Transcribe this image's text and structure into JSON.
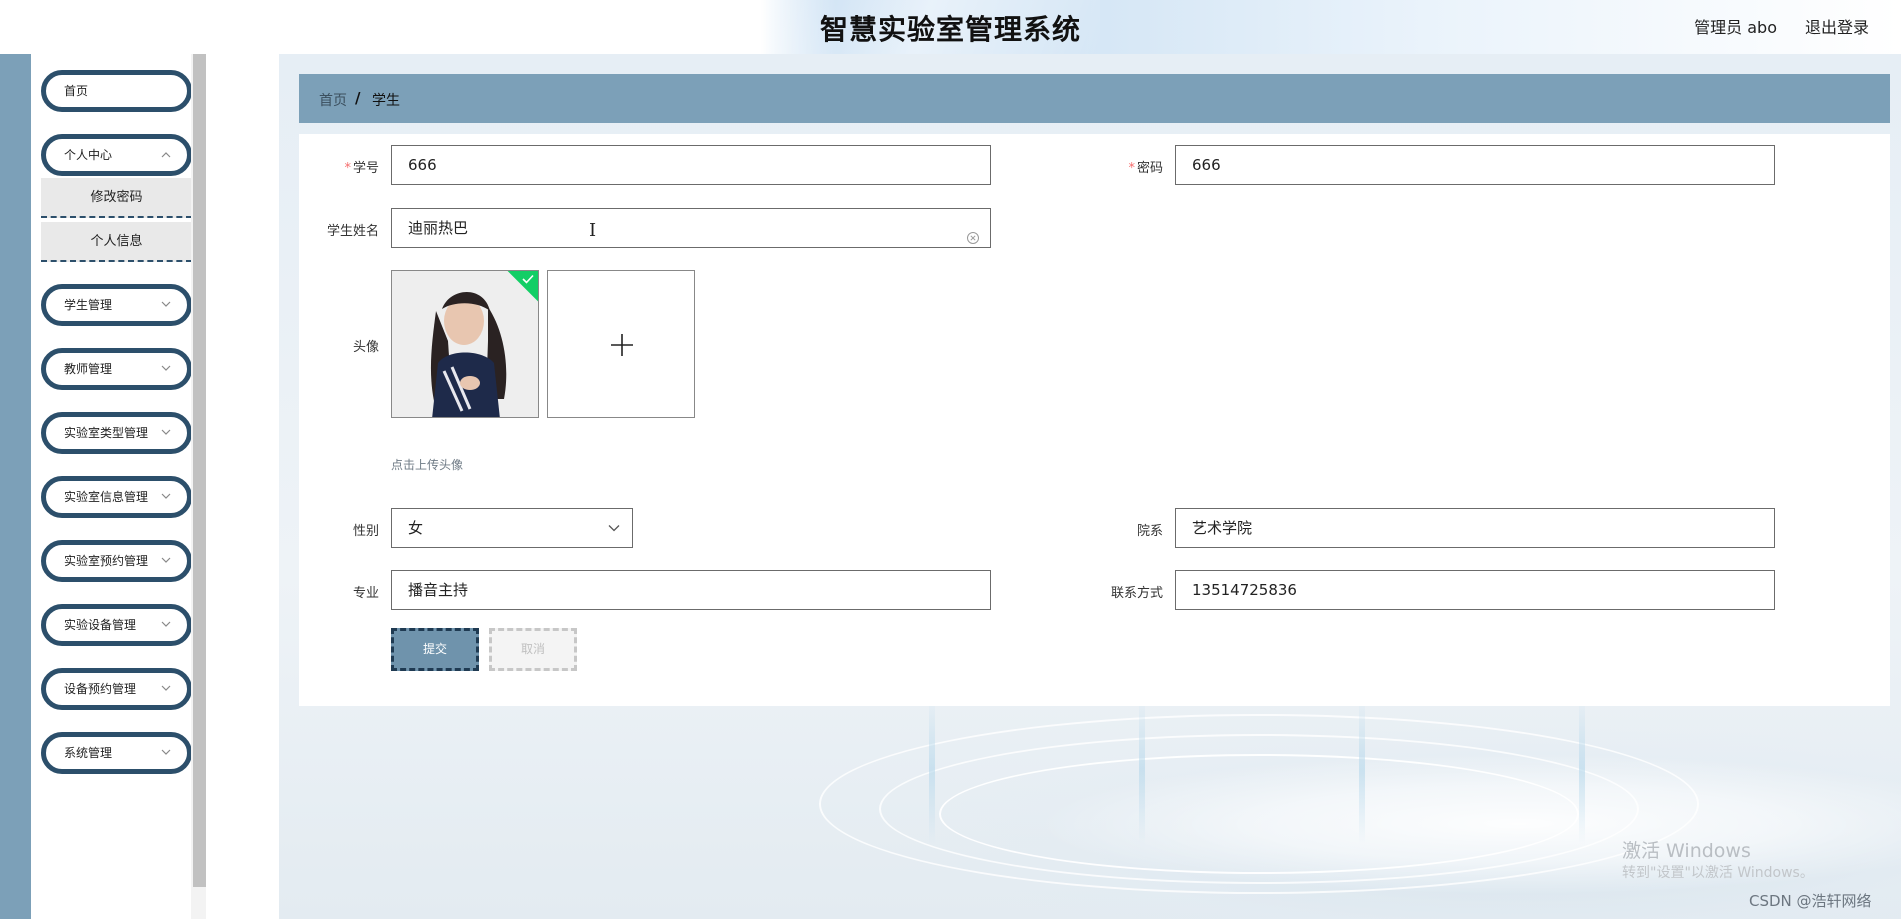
{
  "header": {
    "title": "智慧实验室管理系统",
    "user": "管理员 abo",
    "logout": "退出登录"
  },
  "sidebar": {
    "items": [
      {
        "label": "首页",
        "has_chevron": false
      },
      {
        "label": "个人中心",
        "has_chevron": true,
        "expanded": true
      },
      {
        "label": "学生管理",
        "has_chevron": true
      },
      {
        "label": "教师管理",
        "has_chevron": true
      },
      {
        "label": "实验室类型管理",
        "has_chevron": true
      },
      {
        "label": "实验室信息管理",
        "has_chevron": true
      },
      {
        "label": "实验室预约管理",
        "has_chevron": true
      },
      {
        "label": "实验设备管理",
        "has_chevron": true
      },
      {
        "label": "设备预约管理",
        "has_chevron": true
      },
      {
        "label": "系统管理",
        "has_chevron": true
      }
    ],
    "subitems": [
      {
        "label": "修改密码"
      },
      {
        "label": "个人信息"
      }
    ]
  },
  "breadcrumb": {
    "home": "首页",
    "separator": "/",
    "current": "学生"
  },
  "form": {
    "student_no": {
      "label": "学号",
      "required": true,
      "value": "666"
    },
    "password": {
      "label": "密码",
      "required": true,
      "value": "666"
    },
    "student_name": {
      "label": "学生姓名",
      "value": "迪丽热巴"
    },
    "avatar": {
      "label": "头像",
      "hint": "点击上传头像",
      "uploaded": true
    },
    "gender": {
      "label": "性别",
      "value": "女"
    },
    "department": {
      "label": "院系",
      "value": "艺术学院"
    },
    "major": {
      "label": "专业",
      "value": "播音主持"
    },
    "phone": {
      "label": "联系方式",
      "value": "13514725836"
    },
    "submit_label": "提交",
    "cancel_label": "取消"
  },
  "watermark": {
    "activate_title": "激活 Windows",
    "activate_sub": "转到\"设置\"以激活 Windows。",
    "csdn": "CSDN @浩轩网络"
  },
  "colors": {
    "accent": "#7ca0b8",
    "pill_border": "#2c4f6b",
    "required": "#f56c6c",
    "upload_badge": "#13ce66"
  },
  "icons": {
    "chevron": "chevron-down-icon",
    "clear": "clear-circle-icon",
    "plus": "plus-icon",
    "check": "check-icon"
  }
}
